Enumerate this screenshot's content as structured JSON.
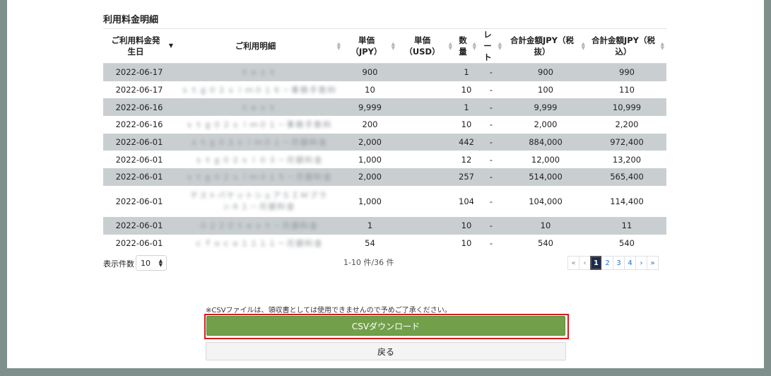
{
  "section_title": "利用料金明細",
  "table": {
    "columns": [
      {
        "label": "ご利用料金発\n生日",
        "sort": "desc"
      },
      {
        "label": "ご利用明細",
        "sort": "none"
      },
      {
        "label": "単価\n（JPY）",
        "sort": "none"
      },
      {
        "label": "単価\n（USD）",
        "sort": "none"
      },
      {
        "label": "数\n量",
        "sort": "none"
      },
      {
        "label": "レー\nト",
        "sort": "none"
      },
      {
        "label": "合計金額JPY（税\n抜）",
        "sort": "none"
      },
      {
        "label": "合計金額JPY（税\n込）",
        "sort": "none"
      }
    ],
    "rows": [
      {
        "date": "2022-06-17",
        "detail": "ｔｅｓｔ",
        "unit_jpy": "900",
        "unit_usd": "",
        "qty": "1",
        "rate": "-",
        "total_ex": "900",
        "total_in": "990"
      },
      {
        "date": "2022-06-17",
        "detail": "ｓｔｇ０２ｓｉｍ０１６－事務手数料",
        "unit_jpy": "10",
        "unit_usd": "",
        "qty": "10",
        "rate": "-",
        "total_ex": "100",
        "total_in": "110"
      },
      {
        "date": "2022-06-16",
        "detail": "ｔｅｓｔ",
        "unit_jpy": "9,999",
        "unit_usd": "",
        "qty": "1",
        "rate": "-",
        "total_ex": "9,999",
        "total_in": "10,999"
      },
      {
        "date": "2022-06-16",
        "detail": "ｓｔｇ０２ｓｉｍ０１－事務手数料",
        "unit_jpy": "200",
        "unit_usd": "",
        "qty": "10",
        "rate": "-",
        "total_ex": "2,000",
        "total_in": "2,200"
      },
      {
        "date": "2022-06-01",
        "detail": "ｓｔｇ０２ｓｉｍ０１－月額料金",
        "unit_jpy": "2,000",
        "unit_usd": "",
        "qty": "442",
        "rate": "-",
        "total_ex": "884,000",
        "total_in": "972,400"
      },
      {
        "date": "2022-06-01",
        "detail": "ｓｔｇ０２ｓｉ０３－月額料金",
        "unit_jpy": "1,000",
        "unit_usd": "",
        "qty": "12",
        "rate": "-",
        "total_ex": "12,000",
        "total_in": "13,200"
      },
      {
        "date": "2022-06-01",
        "detail": "ｓｔｇ０２ｓｉｍ０１５－月額料金",
        "unit_jpy": "2,000",
        "unit_usd": "",
        "qty": "257",
        "rate": "-",
        "total_ex": "514,000",
        "total_in": "565,400"
      },
      {
        "date": "2022-06-01",
        "detail": "テストパケットシェアＳＩＭプランＡ１－月額料金",
        "unit_jpy": "1,000",
        "unit_usd": "",
        "qty": "104",
        "rate": "-",
        "total_ex": "104,000",
        "total_in": "114,400"
      },
      {
        "date": "2022-06-01",
        "detail": "０２２０ｔｅｓｔ－月額料金",
        "unit_jpy": "1",
        "unit_usd": "",
        "qty": "10",
        "rate": "-",
        "total_ex": "10",
        "total_in": "11"
      },
      {
        "date": "2022-06-01",
        "detail": "ｃｆｏｃｅ１１１１－月額料金",
        "unit_jpy": "54",
        "unit_usd": "",
        "qty": "10",
        "rate": "-",
        "total_ex": "540",
        "total_in": "540"
      }
    ]
  },
  "page_size": {
    "label": "表示件数",
    "value": "10"
  },
  "record_count": "1-10 件/36 件",
  "pagination": {
    "first": "«",
    "prev": "‹",
    "next": "›",
    "last": "»",
    "pages": [
      "1",
      "2",
      "3",
      "4"
    ],
    "active_index": 0
  },
  "csv": {
    "note": "※CSVファイルは、領収書としては使用できませんので予めご了承ください。",
    "download_label": "CSVダウンロード",
    "highlight_color": "#d41c1c",
    "button_color": "#72a04a"
  },
  "back_label": "戻る"
}
